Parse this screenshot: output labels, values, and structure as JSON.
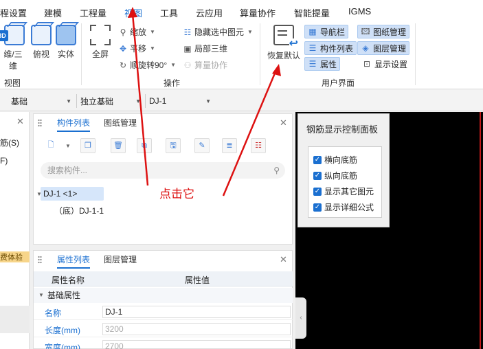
{
  "menu": [
    "程设置",
    "建模",
    "工程量",
    "视图",
    "工具",
    "云应用",
    "算量协作",
    "智能提量",
    "IGMS"
  ],
  "ribbon": {
    "view_group": {
      "label": "视图",
      "btn_3d_badge": "3D",
      "btn_2d3d": "维/三维",
      "btn_top": "俯视",
      "btn_solid": "实体"
    },
    "ops_group": {
      "label": "操作",
      "fullscreen": "全屏",
      "zoom": "缩放",
      "pan": "平移",
      "rotate": "顺旋转90°",
      "hide_selected": "隐藏选中图元",
      "local_3d": "局部三维",
      "collab": "算量协作"
    },
    "ui_group": {
      "label": "用户界面",
      "restore": "恢复默认",
      "nav_bar": "导航栏",
      "drawing_mgmt": "图纸管理",
      "component_list": "构件列表",
      "layer_mgmt": "图层管理",
      "properties": "属性",
      "display_settings": "显示设置"
    }
  },
  "selectors": [
    "基础",
    "独立基础",
    "DJ-1"
  ],
  "left_panel": {
    "line1": "筋(S)",
    "line2": "F)",
    "badge": "费体验"
  },
  "component_panel": {
    "tab_active": "构件列表",
    "tab_other": "图纸管理",
    "search_placeholder": "搜索构件...",
    "tree_root": "DJ-1 <1>",
    "tree_child": "（底）DJ-1-1"
  },
  "property_panel": {
    "tab_active": "属性列表",
    "tab_other": "图层管理",
    "col_name": "属性名称",
    "col_value": "属性值",
    "group": "基础属性",
    "rows": [
      {
        "name": "名称",
        "value": "DJ-1"
      },
      {
        "name": "长度(mm)",
        "value": "3200"
      },
      {
        "name": "宽度(mm)",
        "value": "2700"
      }
    ]
  },
  "rebar_panel": {
    "title": "钢筋显示控制面板",
    "options": [
      "横向底筋",
      "纵向底筋",
      "显示其它图元",
      "显示详细公式"
    ]
  },
  "annotation": {
    "text": "点击它",
    "color": "#dd1111"
  }
}
